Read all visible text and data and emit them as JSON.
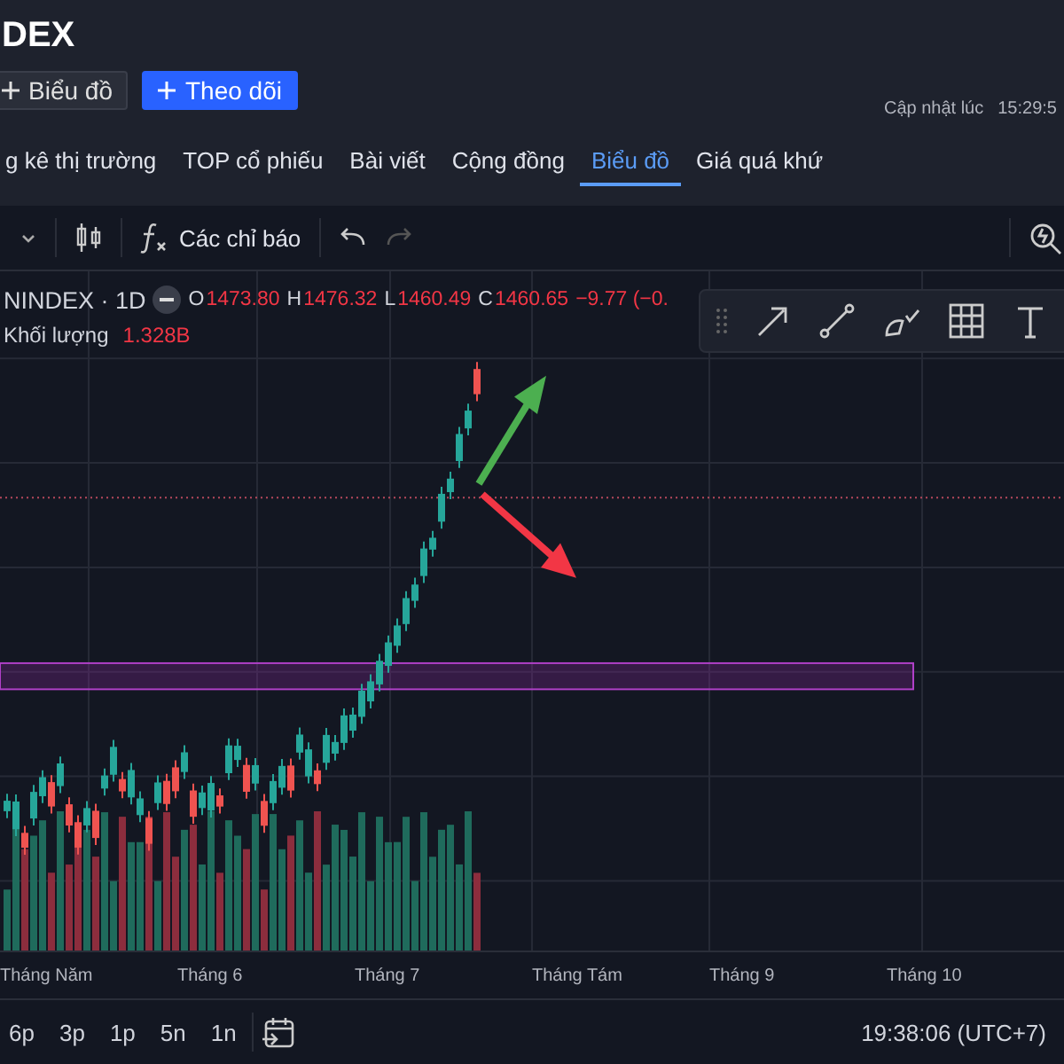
{
  "header": {
    "title": "DEX",
    "buttons": [
      {
        "label": "Biểu đồ",
        "kind": "plain"
      },
      {
        "label": "Theo dõi",
        "kind": "primary"
      }
    ],
    "update_label": "Cập nhật lúc",
    "update_time": "15:29:5"
  },
  "tabs": [
    {
      "label": "g kê thị trường",
      "selected": false
    },
    {
      "label": "TOP cổ phiếu",
      "selected": false
    },
    {
      "label": "Bài viết",
      "selected": false
    },
    {
      "label": "Cộng đồng",
      "selected": false
    },
    {
      "label": "Biểu đồ",
      "selected": true
    },
    {
      "label": "Giá quá khứ",
      "selected": false
    }
  ],
  "toolbar": {
    "indicators": "Các chỉ báo"
  },
  "legend": {
    "symbol": "NINDEX · 1D",
    "ohlc": [
      {
        "key": "O",
        "value": "1473.80"
      },
      {
        "key": "H",
        "value": "1476.32"
      },
      {
        "key": "L",
        "value": "1460.49"
      },
      {
        "key": "C",
        "value": "1460.65"
      }
    ],
    "change": "−9.77 (−0.",
    "volume_label": "Khối lượng",
    "volume_value": "1.328B"
  },
  "x_axis": [
    "Tháng Năm",
    "Tháng 6",
    "Tháng 7",
    "Tháng Tám",
    "Tháng 9",
    "Tháng 10"
  ],
  "bottom_bar": {
    "ranges": [
      "6p",
      "3p",
      "1p",
      "5n",
      "1n"
    ],
    "clock": "19:38:06 (UTC+7)"
  }
}
